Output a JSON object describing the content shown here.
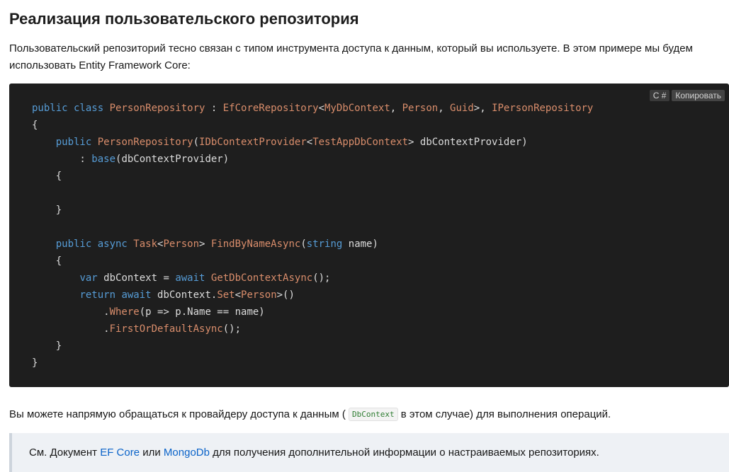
{
  "heading": "Реализация пользовательского репозитория",
  "intro": "Пользовательский репозиторий тесно связан с типом инструмента доступа к данным, который вы используете. В этом примере мы будем использовать Entity Framework Core:",
  "code": {
    "language_label": "C #",
    "copy_label": "Копировать",
    "lines": [
      [
        [
          "k",
          "public class "
        ],
        [
          "t",
          "PersonRepository"
        ],
        [
          "i",
          " : "
        ],
        [
          "t",
          "EfCoreRepository"
        ],
        [
          "i",
          "<"
        ],
        [
          "t",
          "MyDbContext"
        ],
        [
          "i",
          ", "
        ],
        [
          "t",
          "Person"
        ],
        [
          "i",
          ", "
        ],
        [
          "t",
          "Guid"
        ],
        [
          "i",
          ">, "
        ],
        [
          "t",
          "IPersonRepository"
        ]
      ],
      [
        [
          "i",
          "{"
        ]
      ],
      [
        [
          "i",
          "    "
        ],
        [
          "k",
          "public "
        ],
        [
          "t",
          "PersonRepository"
        ],
        [
          "i",
          "("
        ],
        [
          "t",
          "IDbContextProvider"
        ],
        [
          "i",
          "<"
        ],
        [
          "t",
          "TestAppDbContext"
        ],
        [
          "i",
          "> dbContextProvider)"
        ]
      ],
      [
        [
          "i",
          "        : "
        ],
        [
          "k",
          "base"
        ],
        [
          "i",
          "(dbContextProvider)"
        ]
      ],
      [
        [
          "i",
          "    {"
        ]
      ],
      [
        [
          "i",
          ""
        ]
      ],
      [
        [
          "i",
          "    }"
        ]
      ],
      [
        [
          "i",
          ""
        ]
      ],
      [
        [
          "i",
          "    "
        ],
        [
          "k",
          "public async "
        ],
        [
          "t",
          "Task"
        ],
        [
          "i",
          "<"
        ],
        [
          "t",
          "Person"
        ],
        [
          "i",
          "> "
        ],
        [
          "m",
          "FindByNameAsync"
        ],
        [
          "i",
          "("
        ],
        [
          "k",
          "string"
        ],
        [
          "i",
          " name)"
        ]
      ],
      [
        [
          "i",
          "    {"
        ]
      ],
      [
        [
          "i",
          "        "
        ],
        [
          "k",
          "var "
        ],
        [
          "i",
          "dbContext = "
        ],
        [
          "k",
          "await "
        ],
        [
          "m",
          "GetDbContextAsync"
        ],
        [
          "i",
          "();"
        ]
      ],
      [
        [
          "i",
          "        "
        ],
        [
          "k",
          "return await "
        ],
        [
          "i",
          "dbContext."
        ],
        [
          "m",
          "Set"
        ],
        [
          "i",
          "<"
        ],
        [
          "t",
          "Person"
        ],
        [
          "i",
          ">()"
        ]
      ],
      [
        [
          "i",
          "            ."
        ],
        [
          "m",
          "Where"
        ],
        [
          "i",
          "(p => p.Name == name)"
        ]
      ],
      [
        [
          "i",
          "            ."
        ],
        [
          "m",
          "FirstOrDefaultAsync"
        ],
        [
          "i",
          "();"
        ]
      ],
      [
        [
          "i",
          "    }"
        ]
      ],
      [
        [
          "i",
          "}"
        ]
      ]
    ]
  },
  "para": {
    "before": "Вы можете напрямую обращаться к провайдеру доступа к данным (",
    "inline_code": "DbContext",
    "after": "в этом случае) для выполнения операций."
  },
  "note": {
    "before": "См. Документ ",
    "link1": "EF Core",
    "middle": " или ",
    "link2": "MongoDb",
    "after": " для получения дополнительной информации о настраиваемых репозиториях."
  }
}
